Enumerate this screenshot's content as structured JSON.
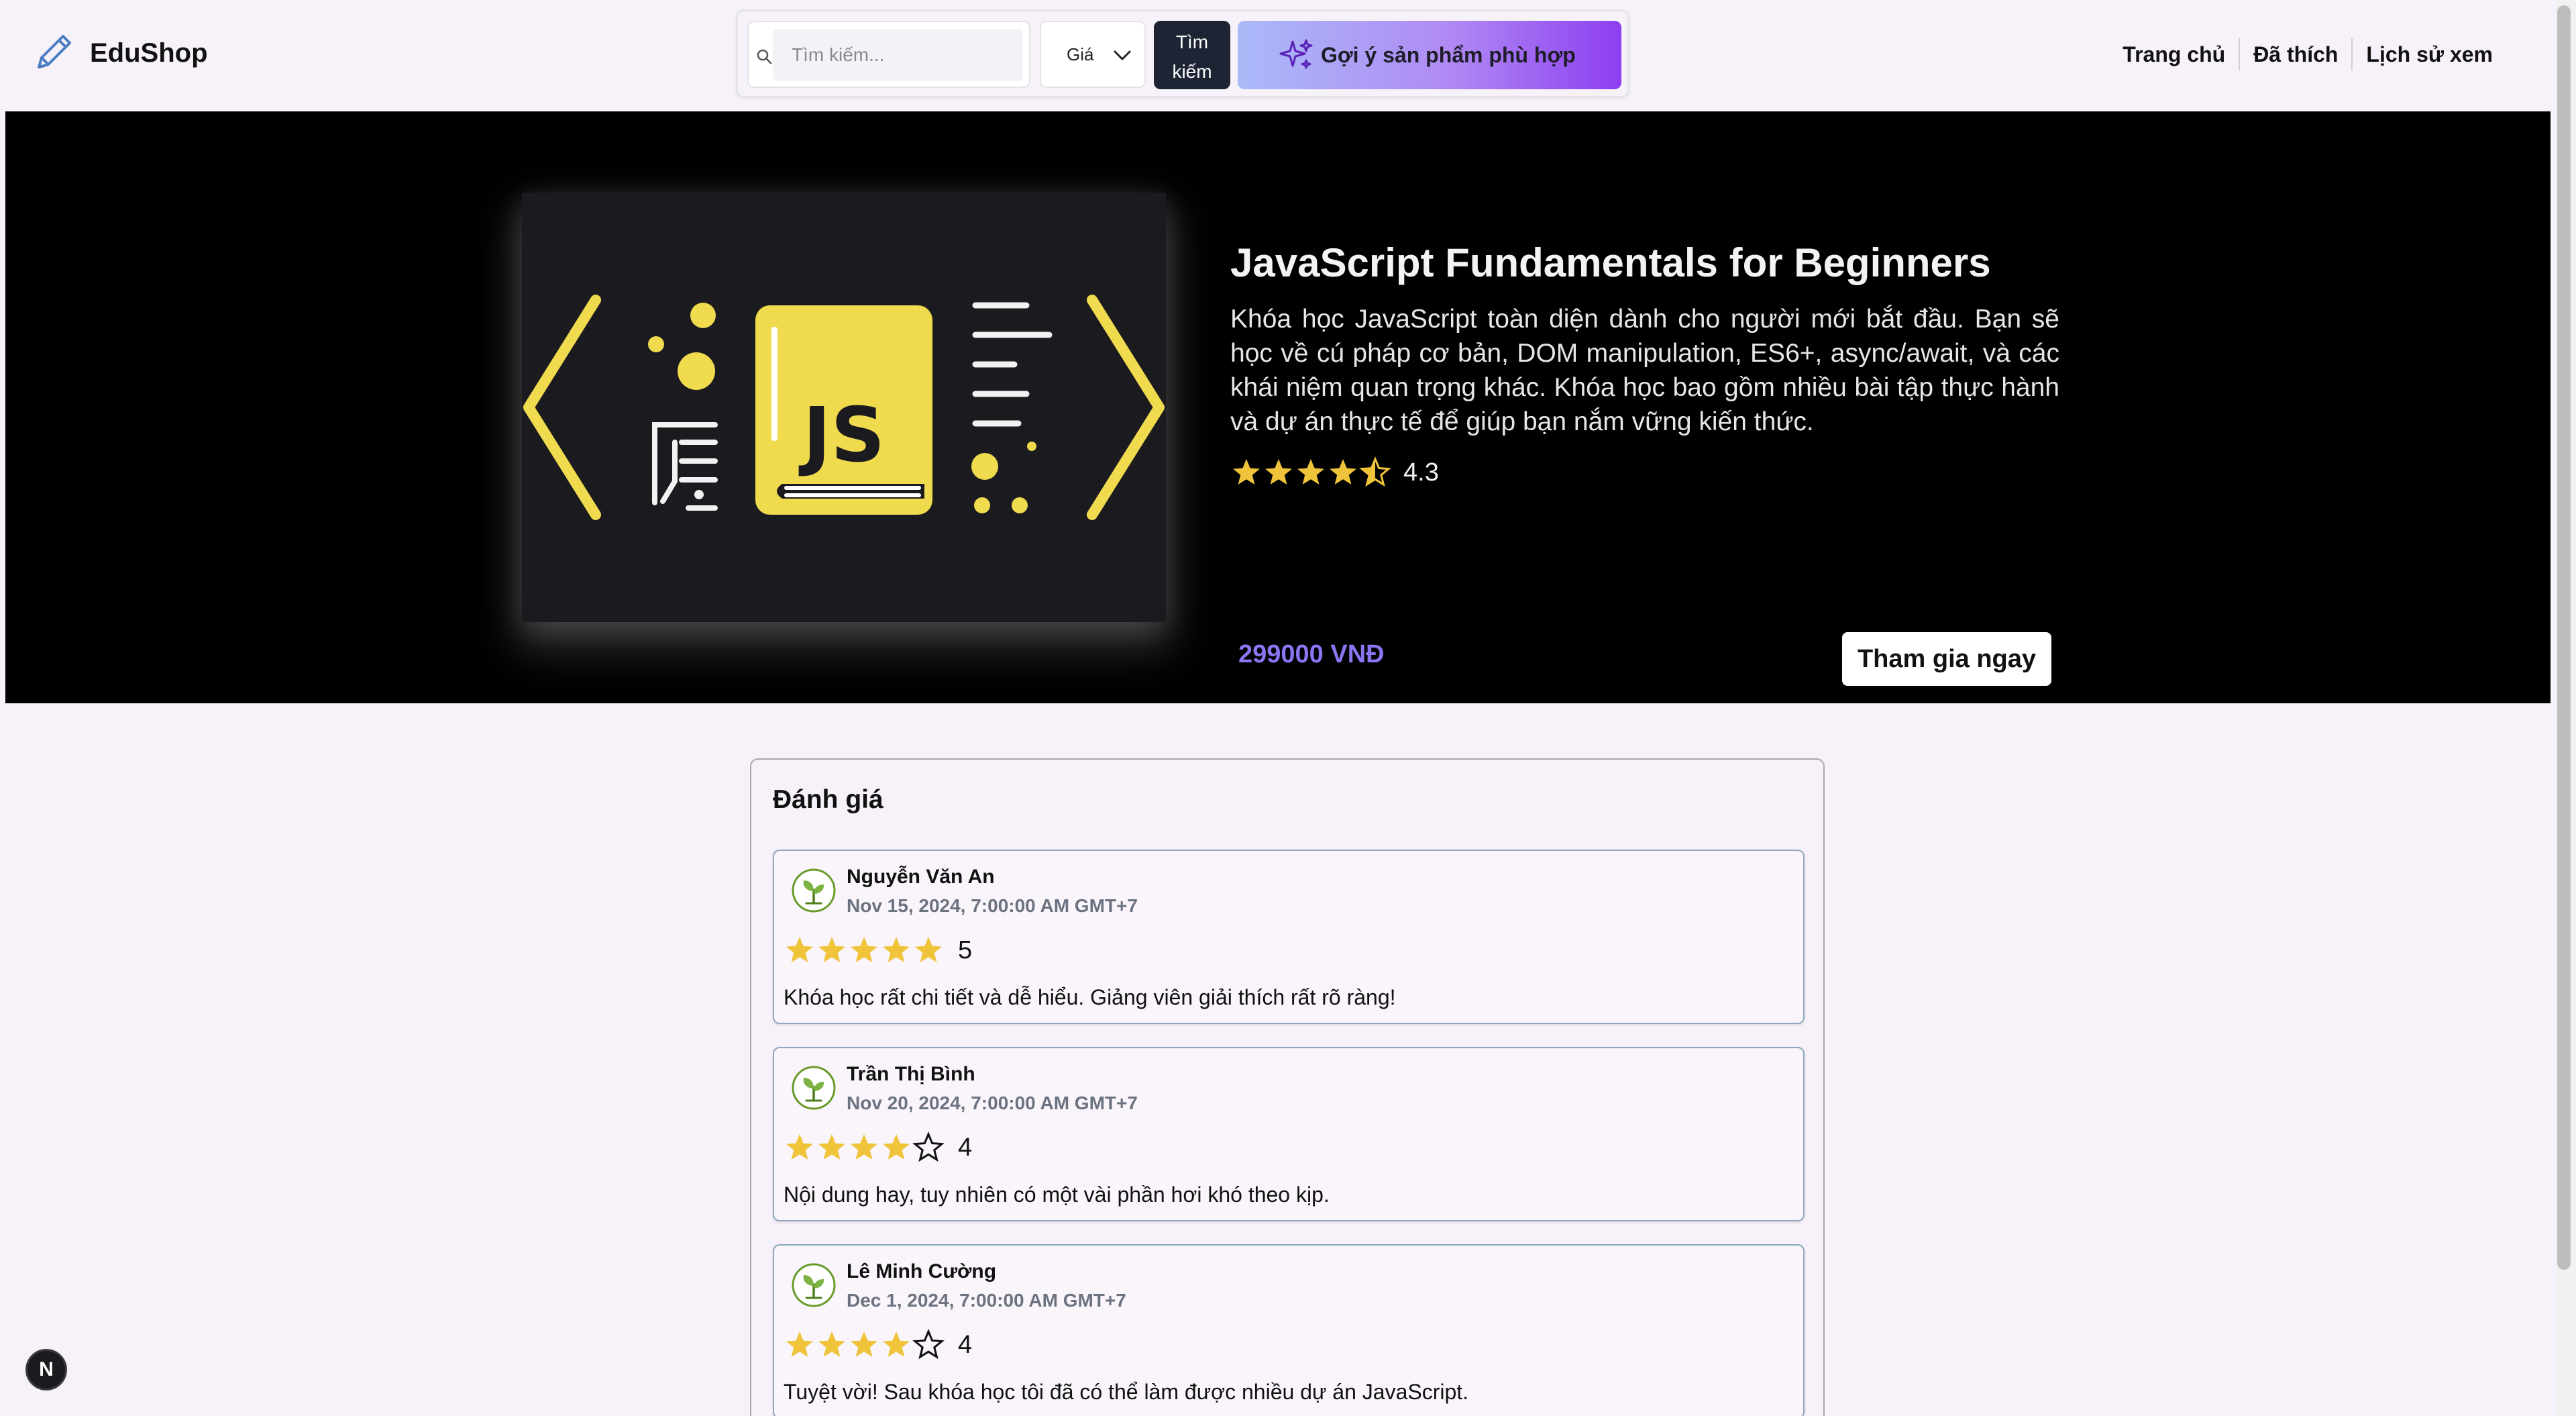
{
  "brand": {
    "name": "EduShop",
    "icon": "pencil-icon"
  },
  "search": {
    "placeholder": "Tìm kiếm...",
    "value": "",
    "price_filter_label": "Giá",
    "submit_label": "Tìm kiếm",
    "suggest_label": "Gợi ý sản phẩm phù hợp"
  },
  "nav": {
    "items": [
      {
        "label": "Trang chủ"
      },
      {
        "label": "Đã thích"
      },
      {
        "label": "Lịch sử xem"
      }
    ]
  },
  "course": {
    "title": "JavaScript Fundamentals for Beginners",
    "description": "Khóa học JavaScript toàn diện dành cho người mới bắt đầu. Bạn sẽ học về cú pháp cơ bản, DOM manipulation, ES6+, async/await, và các khái niệm quan trọng khác. Khóa học bao gồm nhiều bài tập thực hành và dự án thực tế để giúp bạn nắm vững kiến thức.",
    "rating": 4.3,
    "rating_text": "4.3",
    "price": "299000 VNĐ",
    "join_label": "Tham gia ngay",
    "image_text": "JS"
  },
  "reviews": {
    "title": "Đánh giá",
    "items": [
      {
        "name": "Nguyễn Văn An",
        "date": "Nov 15, 2024, 7:00:00 AM GMT+7",
        "score": 5,
        "score_text": "5",
        "text": "Khóa học rất chi tiết và dễ hiểu. Giảng viên giải thích rất rõ ràng!"
      },
      {
        "name": "Trần Thị Bình",
        "date": "Nov 20, 2024, 7:00:00 AM GMT+7",
        "score": 4,
        "score_text": "4",
        "text": "Nội dung hay, tuy nhiên có một vài phần hơi khó theo kịp."
      },
      {
        "name": "Lê Minh Cường",
        "date": "Dec 1, 2024, 7:00:00 AM GMT+7",
        "score": 4,
        "score_text": "4",
        "text": "Tuyệt vời! Sau khóa học tôi đã có thể làm được nhiều dự án JavaScript."
      }
    ]
  },
  "badge": {
    "letter": "N"
  },
  "colors": {
    "accent": "#8c74f3",
    "star": "#f0c43a",
    "js_yellow": "#f0db4f",
    "button_dark": "#1d2433"
  }
}
